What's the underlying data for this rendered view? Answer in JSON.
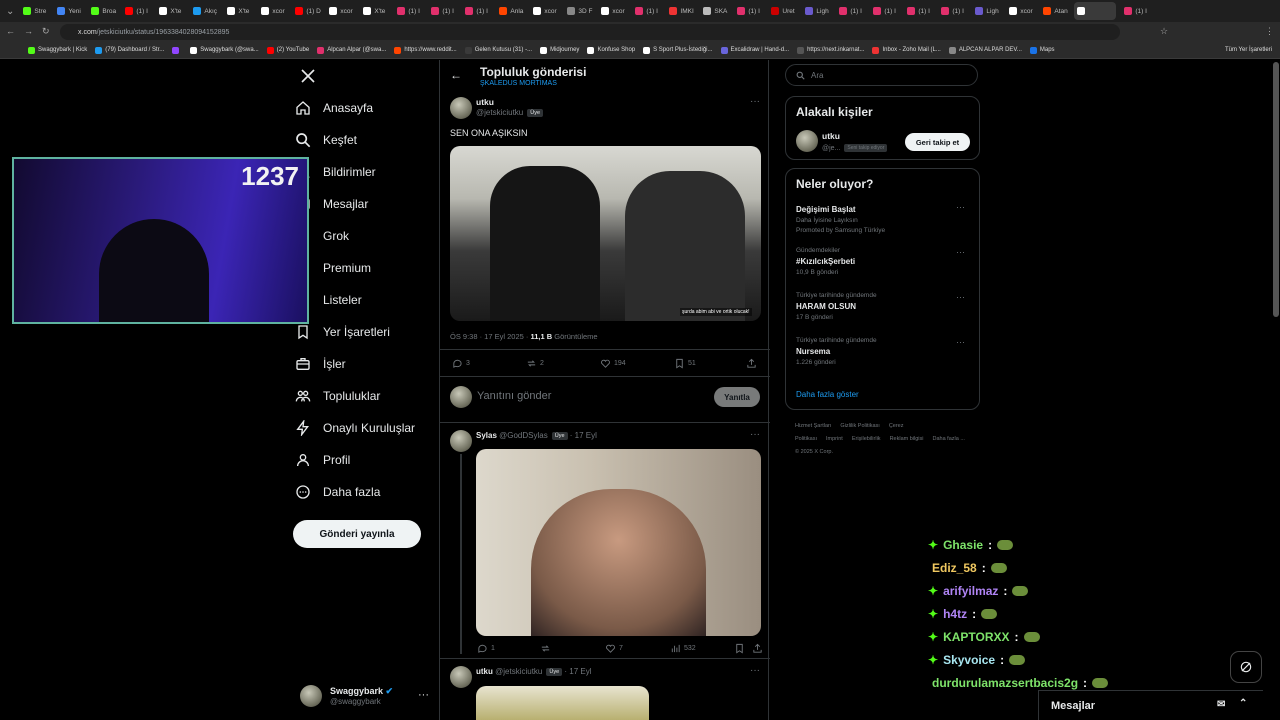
{
  "browser": {
    "tabs": [
      "Stre",
      "Yeni",
      "Broa",
      "(1) I",
      "X'te",
      "Akıç",
      "X'te",
      "xcor",
      "(1) D",
      "xcor",
      "X'te",
      "(1) I",
      "(1) I",
      "(1) I",
      "Anla",
      "xcor",
      "3D F",
      "xcor",
      "(1) I",
      "IMKI",
      "SKA",
      "(1) I",
      "Uret",
      "Ligh",
      "(1) I",
      "(1) I",
      "(1) I",
      "(1) I",
      "Ligh",
      "xcor",
      "Atan",
      "",
      "(1) I"
    ],
    "url_host": "x.com",
    "url_path": "/jetskiciutku/status/1963384028094152895",
    "bookmarks": [
      "Swaggybark | Kick",
      "(79) Dashboard / Str...",
      "",
      "Swaggybark (@swa...",
      "(2) YouTube",
      "Alpcan Alpar (@swa...",
      "https://www.reddit...",
      "Gelen Kutusu (31) -...",
      "Midjourney",
      "Konfuse Shop",
      "S Sport Plus-İstediği...",
      "Excalidraw | Hand-d...",
      "https://next.inkarnat...",
      "Inbox - Zoho Mail (L...",
      "ALPCAN ALPAR DEV...",
      "Maps"
    ],
    "all_bookmarks": "Tüm Yer İşaretleri"
  },
  "nav": {
    "items": [
      "Anasayfa",
      "Keşfet",
      "Bildirimler",
      "Mesajlar",
      "Grok",
      "Premium",
      "Listeler",
      "Yer İşaretleri",
      "İşler",
      "Topluluklar",
      "Onaylı Kuruluşlar",
      "Profil",
      "Daha fazla"
    ],
    "post_button": "Gönderi yayınla",
    "user_name": "Swaggybark",
    "user_handle": "@swaggybark"
  },
  "header": {
    "title": "Topluluk gönderisi",
    "community": "ŞKALEDUS MORTİMAS"
  },
  "post": {
    "name": "utku",
    "handle": "@jetskiciutku",
    "badge": "Üye",
    "text": "SEN ONA AŞIKSIN",
    "video_caption": "şurda abim abi ve ortik olucak!",
    "time": "ÖS 9:38 · 17 Eyl 2025 · ",
    "views": "11,1 B",
    "views_label": "Görüntüleme",
    "replies": "3",
    "reposts": "2",
    "likes": "194",
    "bookmarks": "51"
  },
  "reply_box": {
    "placeholder": "Yanıtını gönder",
    "button": "Yanıtla"
  },
  "reply1": {
    "name": "Sylas",
    "handle": "@GodDSylas",
    "badge": "Üye",
    "time": "· 17 Eyl",
    "replies": "1",
    "reposts": "",
    "likes": "7",
    "views": "532"
  },
  "reply2": {
    "name": "utku",
    "handle": "@jetskiciutku",
    "badge": "Üye",
    "time": "· 17 Eyl"
  },
  "search": {
    "placeholder": "Ara"
  },
  "related": {
    "title": "Alakalı kişiler",
    "name": "utku",
    "handle": "@je...",
    "follows_you": "Seni takip ediyor",
    "button": "Geri takip et"
  },
  "trends": {
    "title": "Neler oluyor?",
    "items": [
      {
        "category": "",
        "name": "Değişimi Başlat",
        "count": "Daha İyisine Layıksın",
        "promo": "Promoted by Samsung Türkiye"
      },
      {
        "category": "Gündemdekiler",
        "name": "#KızılcıkŞerbeti",
        "count": "10,9 B gönderi",
        "promo": ""
      },
      {
        "category": "Türkiye tarihinde gündemde",
        "name": "HARAM OLSUN",
        "count": "17 B gönderi",
        "promo": ""
      },
      {
        "category": "Türkiye tarihinde gündemde",
        "name": "Nursema",
        "count": "1.226 gönderi",
        "promo": ""
      }
    ],
    "show_more": "Daha fazla göster"
  },
  "footer": {
    "links": [
      "Hizmet Şartları",
      "Gizlilik Politikası",
      "Çerez Politikası",
      "Imprint",
      "Erişilebilirlik",
      "Reklam bilgisi",
      "Daha fazla ..."
    ],
    "copyright": "© 2025 X Corp."
  },
  "stream": {
    "viewers": "1237"
  },
  "chat": [
    {
      "user": "Ghasie",
      "color": "#7ee36a"
    },
    {
      "user": "Ediz_58",
      "color": "#f0c860"
    },
    {
      "user": "arifyilmaz",
      "color": "#b084f5"
    },
    {
      "user": "h4tz",
      "color": "#b084f5"
    },
    {
      "user": "KAPTORXX",
      "color": "#7ee36a"
    },
    {
      "user": "Skyvoice",
      "color": "#a8e6f0"
    },
    {
      "user": "durdurulamazsertbacis2g",
      "color": "#7ee36a"
    }
  ],
  "dm": {
    "title": "Mesajlar"
  }
}
